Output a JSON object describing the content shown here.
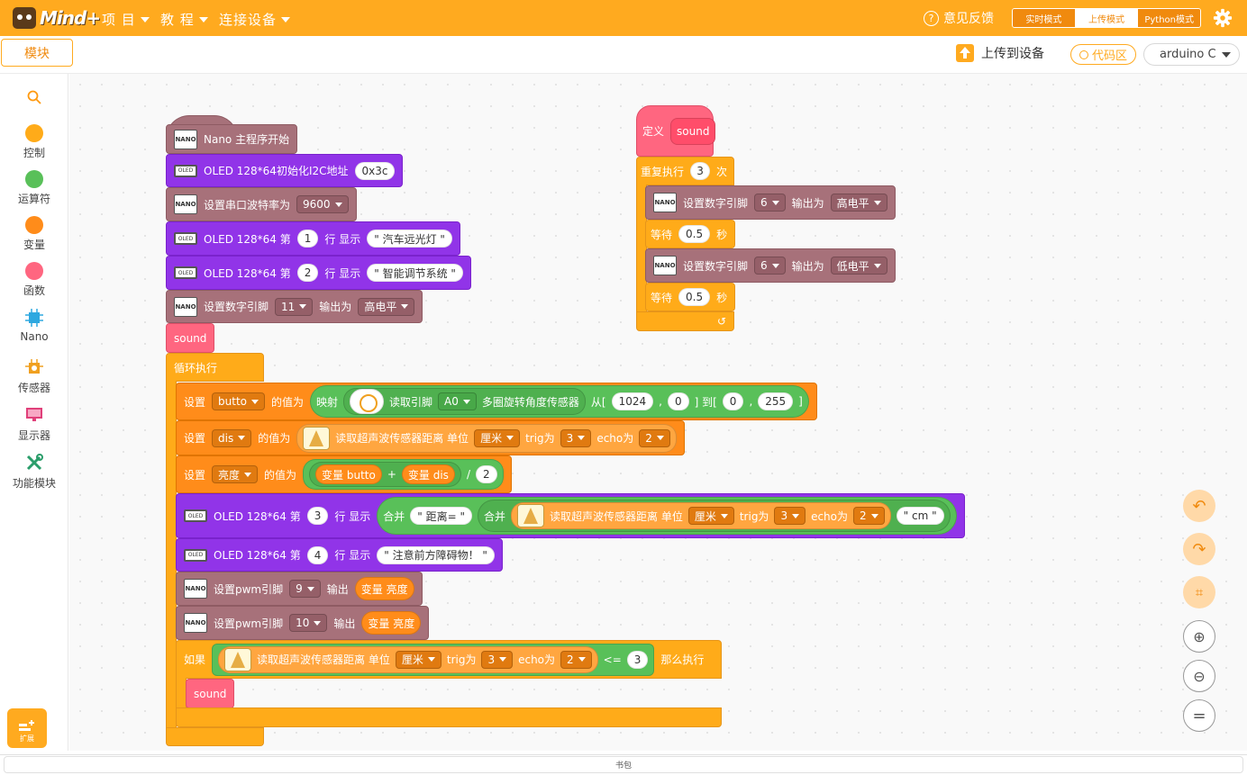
{
  "app": {
    "logo_text": "Mind+"
  },
  "menu": {
    "items": [
      "项 目",
      "教 程",
      "连接设备"
    ]
  },
  "header": {
    "feedback": "意见反馈",
    "modes": [
      "实时模式",
      "上传模式",
      "Python模式"
    ],
    "active_mode": 1
  },
  "subbar": {
    "blocks_tab": "模块",
    "upload": "上传到设备",
    "code_area": "代码区",
    "language": "arduino C"
  },
  "palette": {
    "categories": [
      {
        "label": "控制",
        "color": "#ffab19"
      },
      {
        "label": "运算符",
        "color": "#59c059"
      },
      {
        "label": "变量",
        "color": "#ff8c1a"
      },
      {
        "label": "函数",
        "color": "#ff6680"
      },
      {
        "label": "Nano",
        "color": "#2ea8e0"
      },
      {
        "label": "传感器",
        "color": "#f0a020"
      },
      {
        "label": "显示器",
        "color": "#e0407a"
      },
      {
        "label": "功能模块",
        "color": "#2a9d6a"
      }
    ],
    "extension": "扩展"
  },
  "bottom": {
    "bookbag": "书包"
  },
  "program": {
    "icons": {
      "nano": "NANO",
      "oled": "OLED"
    },
    "main_start": "Nano 主程序开始",
    "oled_init": {
      "label": "OLED 128*64初始化I2C地址",
      "addr": "0x3c"
    },
    "serial": {
      "label": "设置串口波特率为",
      "baud": "9600"
    },
    "oled_line": {
      "prefix": "OLED 128*64 第",
      "mid": "行 显示"
    },
    "oled1": {
      "line": "1",
      "text": "\" 汽车远光灯 \""
    },
    "oled2": {
      "line": "2",
      "text": "\" 智能调节系统 \""
    },
    "digital": {
      "label": "设置数字引脚",
      "out": "输出为",
      "pin": "11",
      "level": "高电平"
    },
    "call_sound": "sound",
    "loop": "循环执行",
    "set": "设置",
    "value_of": "的值为",
    "butto": {
      "var": "butto",
      "map": "映射",
      "read": "读取引脚",
      "pin": "A0",
      "sensor": "多圈旋转角度传感器",
      "from": "从[",
      "from_a": "1024",
      "from_b": "0",
      "to": "] 到[",
      "to_a": "0",
      "to_b": "255",
      "end": "]",
      "comma": ","
    },
    "dis": {
      "var": "dis"
    },
    "ultra": {
      "label": "读取超声波传感器距离 单位",
      "unit": "厘米",
      "trig": "trig为",
      "trig_pin": "3",
      "echo": "echo为",
      "echo_pin": "2"
    },
    "bright": {
      "var": "亮度",
      "v1": "变量 butto",
      "plus": "+",
      "v2": "变量 dis",
      "div": "/",
      "d": "2"
    },
    "oled3": {
      "line": "3",
      "join": "合并",
      "t1": "\" 距离= \"",
      "t2": "\" cm \""
    },
    "oled4": {
      "line": "4",
      "text": "\" 注意前方障碍物！ \""
    },
    "pwm": {
      "label": "设置pwm引脚",
      "out": "输出",
      "p1": "9",
      "p2": "10",
      "var": "变量 亮度"
    },
    "if": {
      "label": "如果",
      "op": "<=",
      "num": "3",
      "then": "那么执行"
    },
    "define": {
      "label": "定义",
      "name": "sound"
    },
    "repeat": {
      "label": "重复执行",
      "n": "3",
      "times": "次"
    },
    "pin6": {
      "pin": "6",
      "high": "高电平",
      "low": "低电平"
    },
    "wait": {
      "label": "等待",
      "sec": "0.5",
      "unit": "秒"
    }
  }
}
